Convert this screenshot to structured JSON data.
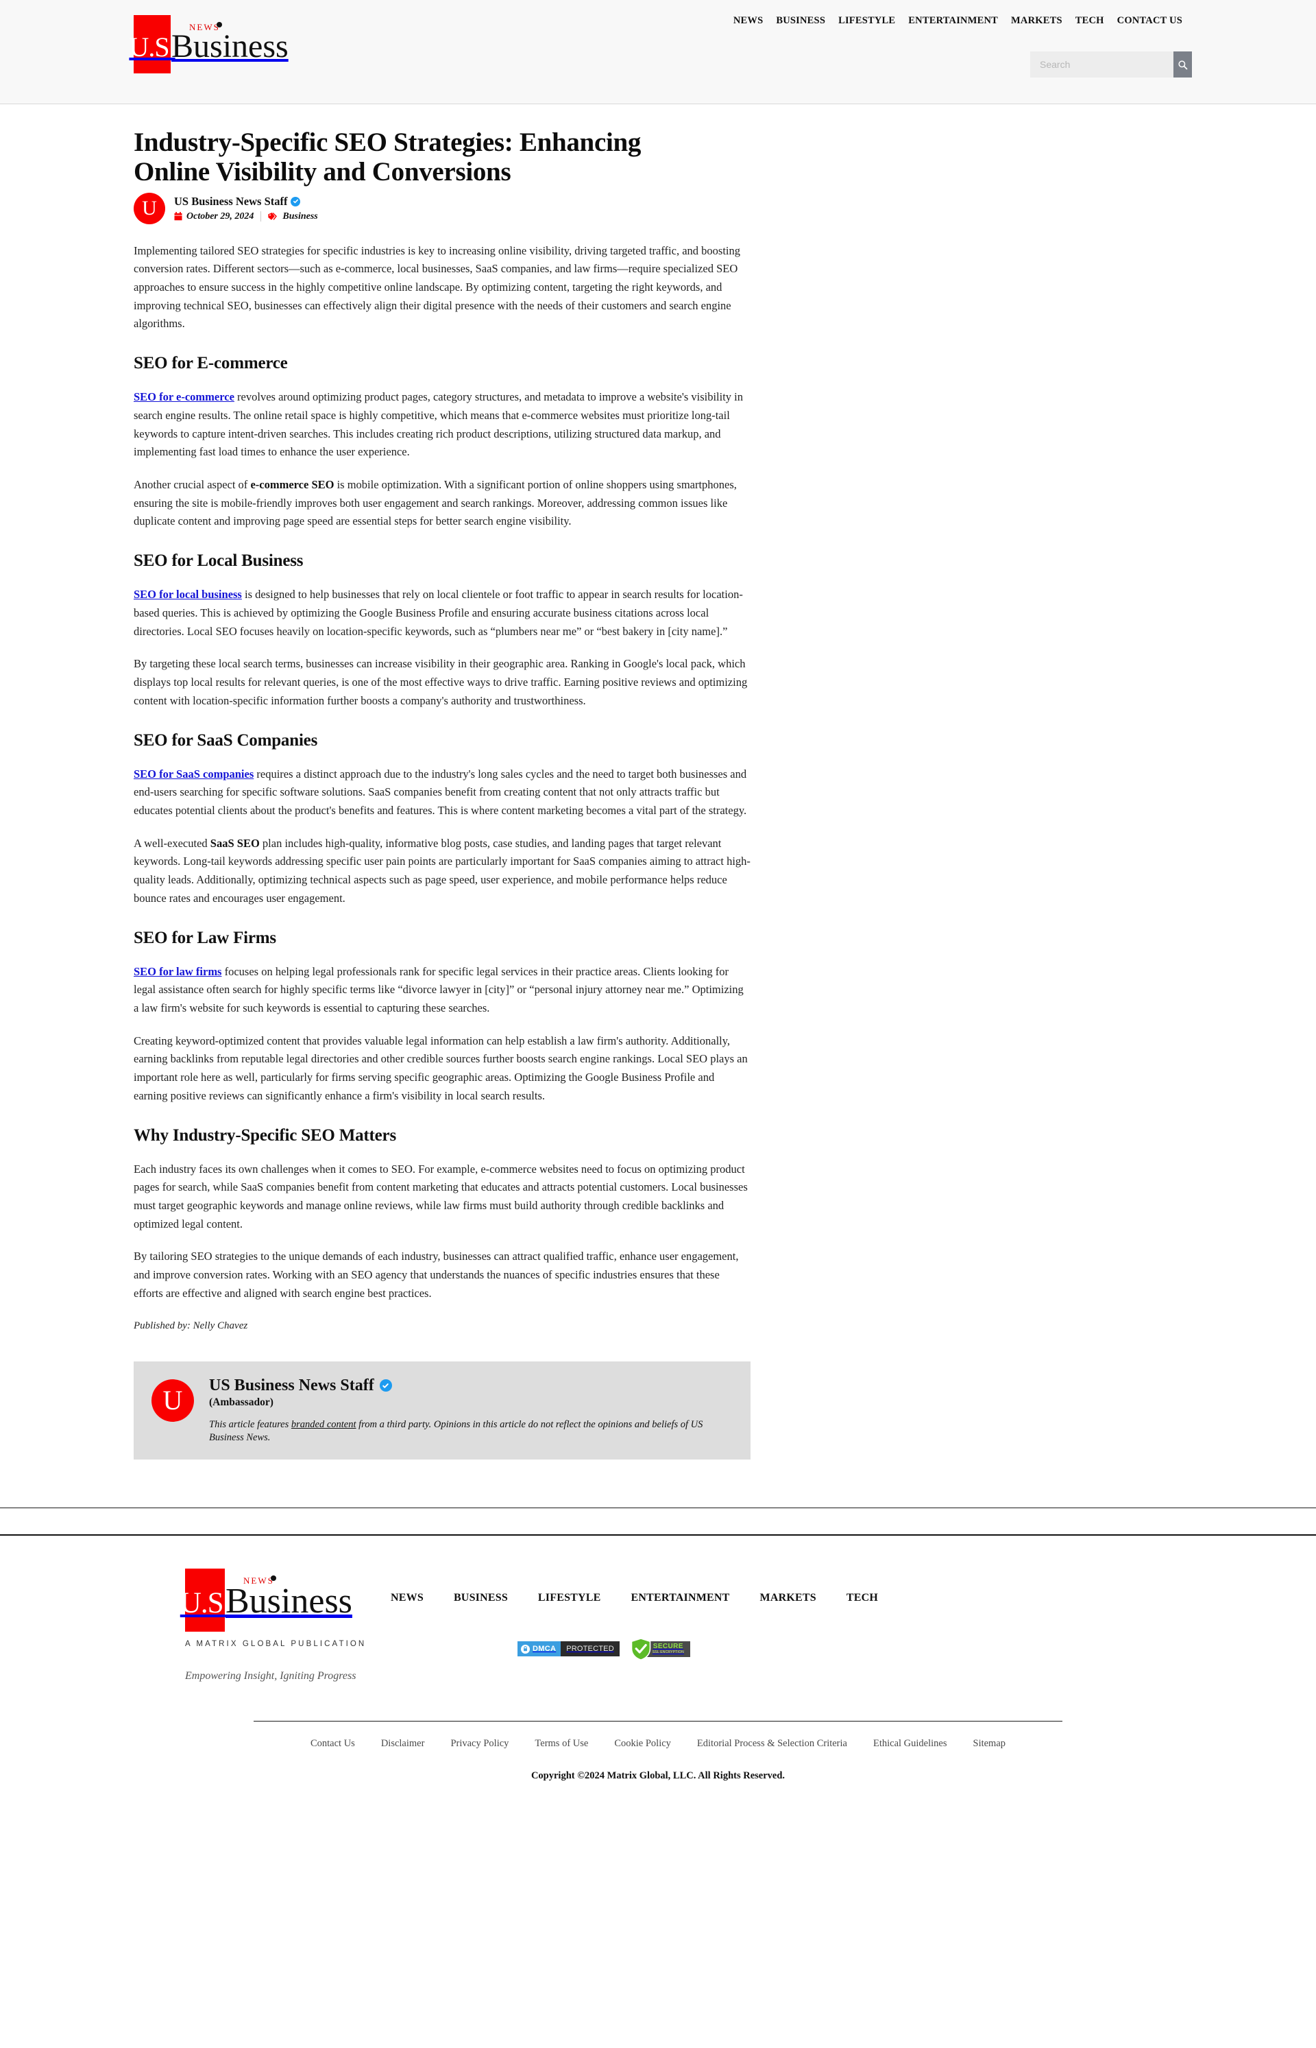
{
  "brand": {
    "box_text": "U.S.",
    "word": "Business",
    "news_tag": "NEWS",
    "accent_red": "#f90000",
    "footer_subtitle": "A MATRIX GLOBAL PUBLICATION",
    "footer_tagline": "Empowering Insight, Igniting Progress"
  },
  "header": {
    "nav": [
      {
        "label": "NEWS"
      },
      {
        "label": "BUSINESS"
      },
      {
        "label": "LIFESTYLE"
      },
      {
        "label": "ENTERTAINMENT"
      },
      {
        "label": "MARKETS"
      },
      {
        "label": "TECH"
      },
      {
        "label": "CONTACT US"
      }
    ],
    "search": {
      "placeholder": "Search",
      "value": "",
      "button_icon": "search-icon"
    }
  },
  "article": {
    "title": "Industry-Specific SEO Strategies: Enhancing Online Visibility and Conversions",
    "author": "US Business News Staff",
    "author_initial": "U",
    "verified": true,
    "date": "October 29, 2024",
    "category": "Business",
    "intro": "Implementing tailored SEO strategies for specific industries is key to increasing online visibility, driving targeted traffic, and boosting conversion rates. Different sectors—such as e-commerce, local businesses, SaaS companies, and law firms—require specialized SEO approaches to ensure success in the highly competitive online landscape. By optimizing content, targeting the right keywords, and improving technical SEO, businesses can effectively align their digital presence with the needs of their customers and search engine algorithms.",
    "sections": [
      {
        "heading": "SEO for E-commerce",
        "link_text": "SEO for e-commerce",
        "p1_rest": " revolves around optimizing product pages, category structures, and metadata to improve a website's visibility in search engine results. The online retail space is highly competitive, which means that e-commerce websites must prioritize long-tail keywords to capture intent-driven searches. This includes creating rich product descriptions, utilizing structured data markup, and implementing fast load times to enhance the user experience.",
        "p2_pre": "Another crucial aspect of ",
        "p2_bold": "e-commerce SEO",
        "p2_rest": " is mobile optimization. With a significant portion of online shoppers using smartphones, ensuring the site is mobile-friendly improves both user engagement and search rankings. Moreover, addressing common issues like duplicate content and improving page speed are essential steps for better search engine visibility."
      },
      {
        "heading": "SEO for Local Business",
        "link_text": "SEO for local business",
        "p1_rest": " is designed to help businesses that rely on local clientele or foot traffic to appear in search results for location-based queries. This is achieved by optimizing the Google Business Profile and ensuring accurate business citations across local directories. Local SEO focuses heavily on location-specific keywords, such as “plumbers near me” or “best bakery in [city name].”",
        "p2_pre": "By targeting these local search terms, businesses can increase visibility in their geographic area. Ranking in Google's local pack, which displays top local results for relevant queries, is one of the most effective ways to drive traffic. Earning positive reviews and optimizing content with location-specific information further boosts a company's authority and trustworthiness.",
        "p2_bold": "",
        "p2_rest": ""
      },
      {
        "heading": "SEO for SaaS Companies",
        "link_text": "SEO for SaaS companies",
        "p1_rest": " requires a distinct approach due to the industry's long sales cycles and the need to target both businesses and end-users searching for specific software solutions. SaaS companies benefit from creating content that not only attracts traffic but educates potential clients about the product's benefits and features. This is where content marketing becomes a vital part of the strategy.",
        "p2_pre": "A well-executed ",
        "p2_bold": "SaaS SEO",
        "p2_rest": " plan includes high-quality, informative blog posts, case studies, and landing pages that target relevant keywords. Long-tail keywords addressing specific user pain points are particularly important for SaaS companies aiming to attract high-quality leads. Additionally, optimizing technical aspects such as page speed, user experience, and mobile performance helps reduce bounce rates and encourages user engagement."
      },
      {
        "heading": "SEO for Law Firms",
        "link_text": "SEO for law firms",
        "p1_rest": " focuses on helping legal professionals rank for specific legal services in their practice areas. Clients looking for legal assistance often search for highly specific terms like “divorce lawyer in [city]” or “personal injury attorney near me.” Optimizing a law firm's website for such keywords is essential to capturing these searches.",
        "p2_pre": "Creating keyword-optimized content that provides valuable legal information can help establish a law firm's authority. Additionally, earning backlinks from reputable legal directories and other credible sources further boosts search engine rankings. Local SEO plays an important role here as well, particularly for firms serving specific geographic areas. Optimizing the Google Business Profile and earning positive reviews can significantly enhance a firm's visibility in local search results.",
        "p2_bold": "",
        "p2_rest": ""
      }
    ],
    "why_heading": "Why Industry-Specific SEO Matters",
    "why_p1": "Each industry faces its own challenges when it comes to SEO. For example, e-commerce websites need to focus on optimizing product pages for search, while SaaS companies benefit from content marketing that educates and attracts potential customers. Local businesses must target geographic keywords and manage online reviews, while law firms must build authority through credible backlinks and optimized legal content.",
    "why_p2": "By tailoring SEO strategies to the unique demands of each industry, businesses can attract qualified traffic, enhance user engagement, and improve conversion rates. Working with an SEO agency that understands the nuances of specific industries ensures that these efforts are effective and aligned with search engine best practices.",
    "published_by": "Published by: Nelly Chavez"
  },
  "author_box": {
    "initial": "U",
    "name": "US Business News Staff",
    "role": "(Ambassador)",
    "disclaimer_pre": "This article features ",
    "disclaimer_link": "branded content",
    "disclaimer_post": " from a third party. Opinions in this article do not reflect the opinions and beliefs of US Business News."
  },
  "footer": {
    "nav": [
      {
        "label": "NEWS"
      },
      {
        "label": "BUSINESS"
      },
      {
        "label": "LIFESTYLE"
      },
      {
        "label": "ENTERTAINMENT"
      },
      {
        "label": "MARKETS"
      },
      {
        "label": "TECH"
      }
    ],
    "badges": {
      "dmca_left": "DMCA",
      "dmca_right": "PROTECTED",
      "ssl_main": "SECURE",
      "ssl_sub": "SSL ENCRYPTION"
    },
    "links": [
      {
        "label": "Contact Us"
      },
      {
        "label": "Disclaimer"
      },
      {
        "label": "Privacy Policy"
      },
      {
        "label": "Terms of Use"
      },
      {
        "label": "Cookie Policy"
      },
      {
        "label": "Editorial Process & Selection Criteria"
      },
      {
        "label": "Ethical Guidelines"
      },
      {
        "label": "Sitemap"
      }
    ],
    "copyright": "Copyright ©2024 Matrix Global, LLC. All Rights Reserved."
  }
}
